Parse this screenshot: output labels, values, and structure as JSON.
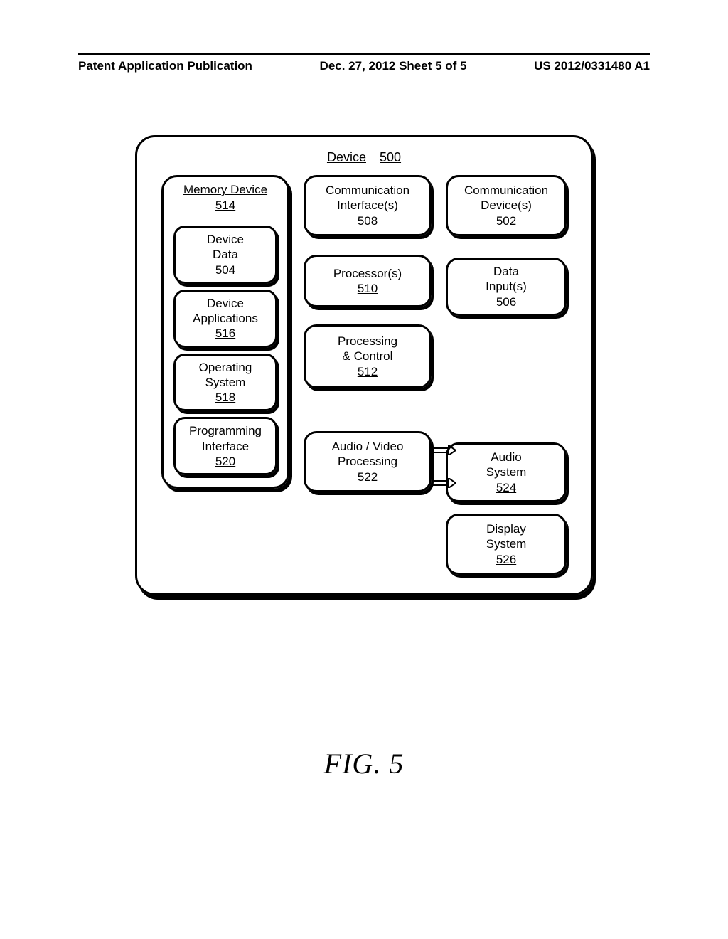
{
  "header": {
    "left": "Patent Application Publication",
    "center": "Dec. 27, 2012  Sheet 5 of 5",
    "right": "US 2012/0331480 A1"
  },
  "device": {
    "title_label": "Device",
    "title_num": "500"
  },
  "memory": {
    "title": "Memory Device",
    "num": "514",
    "device_data_label": "Device\nData",
    "device_data_num": "504",
    "device_apps_label": "Device\nApplications",
    "device_apps_num": "516",
    "os_label": "Operating\nSystem",
    "os_num": "518",
    "prog_if_label": "Programming\nInterface",
    "prog_if_num": "520"
  },
  "mid": {
    "comm_if_label": "Communication\nInterface(s)",
    "comm_if_num": "508",
    "proc_label": "Processor(s)",
    "proc_num": "510",
    "pctrl_label": "Processing\n& Control",
    "pctrl_num": "512",
    "avproc_label": "Audio / Video\nProcessing",
    "avproc_num": "522"
  },
  "right": {
    "comm_dev_label": "Communication\nDevice(s)",
    "comm_dev_num": "502",
    "data_in_label": "Data\nInput(s)",
    "data_in_num": "506",
    "audio_label": "Audio\nSystem",
    "audio_num": "524",
    "display_label": "Display\nSystem",
    "display_num": "526"
  },
  "caption": {
    "prefix": "F",
    "rest": "IG",
    "dot_num": ". 5"
  }
}
